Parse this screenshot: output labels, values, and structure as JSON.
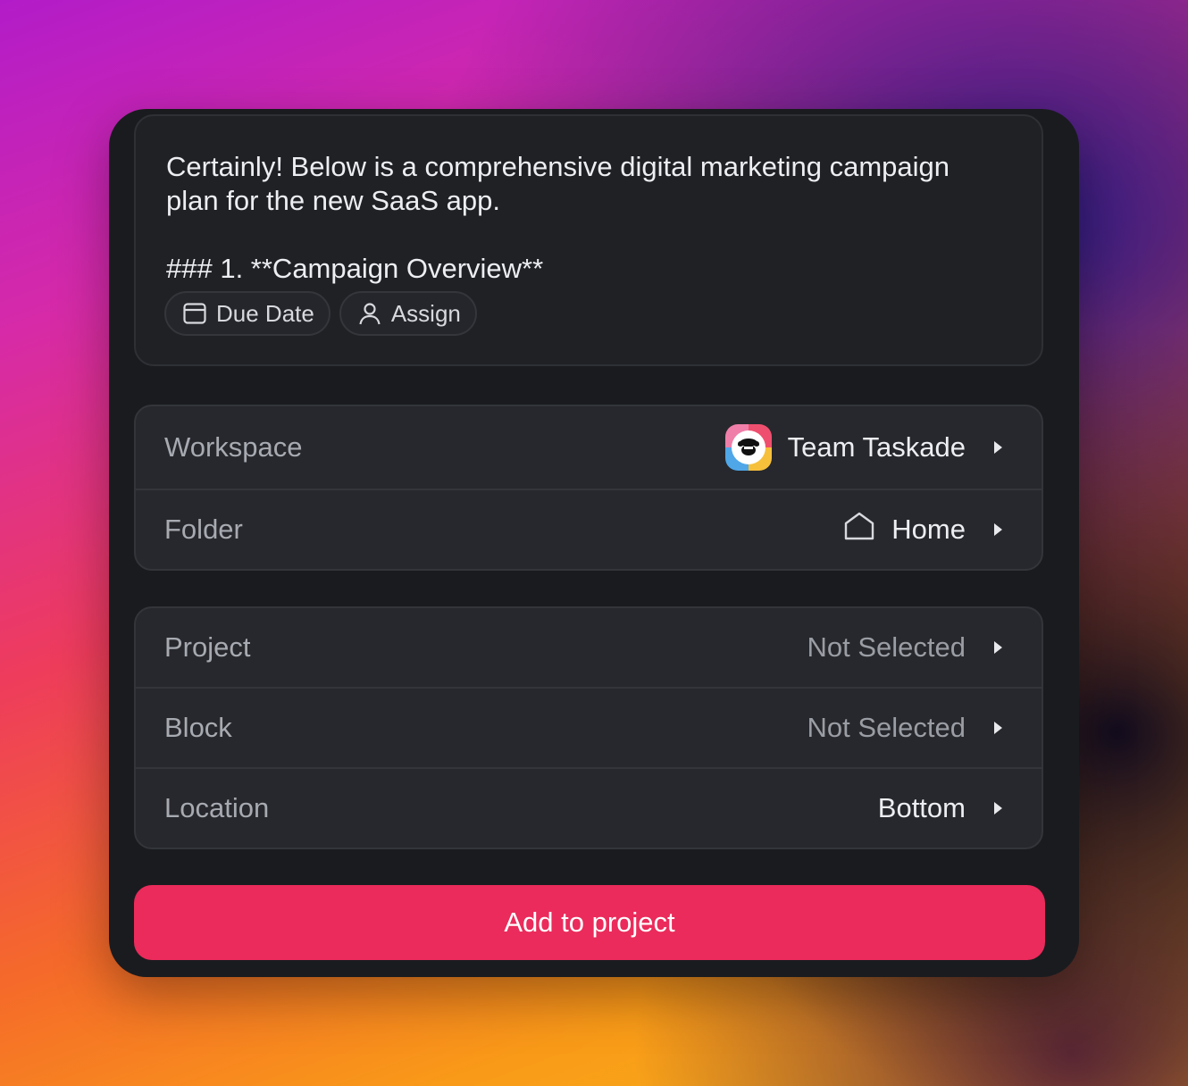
{
  "message": {
    "text": "Certainly! Below is a comprehensive digital marketing campaign\nplan for the new SaaS app.\n\n### 1. **Campaign Overview**"
  },
  "chips": {
    "due_date": {
      "label": "Due Date",
      "icon": "calendar-icon"
    },
    "assign": {
      "label": "Assign",
      "icon": "user-icon"
    }
  },
  "destination": {
    "workspace": {
      "label": "Workspace",
      "value": "Team Taskade",
      "icon": "team-avatar"
    },
    "folder": {
      "label": "Folder",
      "value": "Home",
      "icon": "home-icon"
    }
  },
  "target": {
    "project": {
      "label": "Project",
      "value": "Not Selected"
    },
    "block": {
      "label": "Block",
      "value": "Not Selected"
    },
    "location": {
      "label": "Location",
      "value": "Bottom"
    }
  },
  "actions": {
    "submit_label": "Add to project"
  },
  "colors": {
    "accent": "#ea2b5b",
    "panel": "#1a1b1f"
  }
}
